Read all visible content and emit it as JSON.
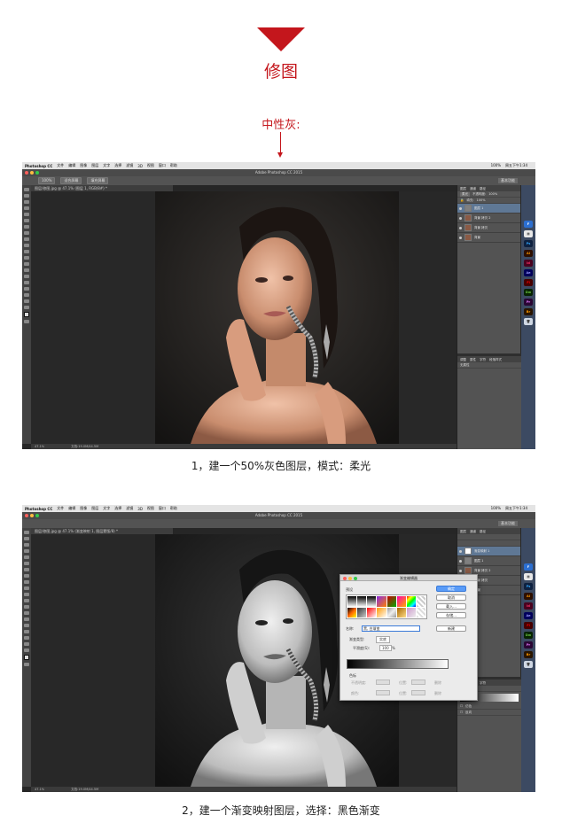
{
  "header": {
    "title": "修图",
    "neutral_gray_label": "中性灰:"
  },
  "captions": {
    "step1": "1，建一个50%灰色图层，模式：柔光",
    "step2": "2，建一个渐变映射图层，选择：黑色渐变"
  },
  "screenshot1": {
    "menubar": {
      "app": "Photoshop CC",
      "items": [
        "文件",
        "编辑",
        "图像",
        "图层",
        "文字",
        "选择",
        "滤镜",
        "3D",
        "视图",
        "窗口",
        "帮助"
      ],
      "status": [
        "100%",
        "周五下午1:34"
      ]
    },
    "window_title": "Adobe Photoshop CC 2015",
    "options": [
      "100%",
      "适合屏幕",
      "填充屏幕"
    ],
    "workspace": "基本功能",
    "doc_tab": "图层/修图.jpg @ 47.1% (图层 1, RGB/8#) *",
    "status_zoom": "47.1%",
    "status_doc": "文档:19.0M/44.5M",
    "layers_tabs": [
      "图层",
      "通道",
      "路径"
    ],
    "blend_mode": "柔光",
    "opacity_label": "不透明度:",
    "opacity_value": "100%",
    "fill_label": "填充:",
    "fill_value": "100%",
    "layers": [
      {
        "name": "图层 1",
        "selected": true
      },
      {
        "name": "背景 拷贝 2",
        "selected": false
      },
      {
        "name": "背景 拷贝",
        "selected": false
      },
      {
        "name": "背景",
        "selected": false
      }
    ],
    "adjust_tabs": [
      "调整",
      "属性",
      "字符",
      "段落样式"
    ],
    "adjust_label": "无属性"
  },
  "screenshot2": {
    "menubar": {
      "app": "Photoshop CC",
      "items": [
        "文件",
        "编辑",
        "图像",
        "图层",
        "文字",
        "选择",
        "滤镜",
        "3D",
        "视图",
        "窗口",
        "帮助"
      ],
      "status": [
        "100%",
        "周五下午1:34"
      ]
    },
    "window_title": "Adobe Photoshop CC 2015",
    "doc_tab": "图层/修图.jpg @ 47.1% (渐变映射 1, 图层蒙版/8) *",
    "workspace": "基本功能",
    "status_zoom": "47.1%",
    "status_doc": "文档:19.0M/44.5M",
    "layers": [
      {
        "name": "渐变映射 1",
        "selected": true
      },
      {
        "name": "图层 1",
        "selected": false
      },
      {
        "name": "背景 拷贝 2",
        "selected": false
      },
      {
        "name": "背景 拷贝",
        "selected": false
      },
      {
        "name": "背景",
        "selected": false
      }
    ],
    "props_label": "渐变映射",
    "props_options": [
      "仿色",
      "反向"
    ],
    "dialog": {
      "title": "渐变编辑器",
      "presets_label": "预设",
      "buttons": [
        "确定",
        "取消",
        "载入...",
        "存储...",
        "新建"
      ],
      "name_label": "名称:",
      "name_value": "黑, 白渐变",
      "type_label": "渐变类型:",
      "type_value": "实底",
      "smooth_label": "平滑度(S):",
      "smooth_value": "100",
      "smooth_unit": "%",
      "stops_label": "色标",
      "stop_fields": [
        "不透明度:",
        "位置:",
        "删除",
        "颜色:",
        "位置:",
        "删除"
      ]
    }
  },
  "colors": {
    "accent_red": "#c4161c",
    "ps_dark": "#262626",
    "panel": "#535353",
    "selection": "#5f7895"
  }
}
